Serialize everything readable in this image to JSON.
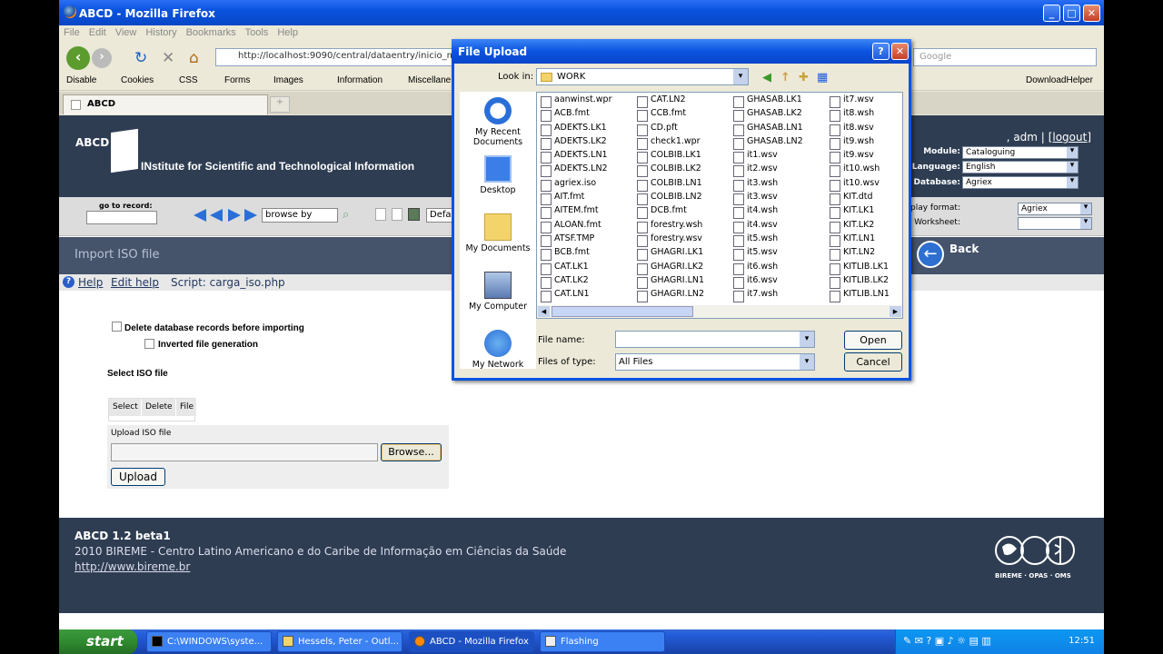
{
  "window": {
    "title": "ABCD - Mozilla Firefox"
  },
  "menu": [
    "File",
    "Edit",
    "View",
    "History",
    "Bookmarks",
    "Tools",
    "Help"
  ],
  "nav": {
    "url": "http://localhost:9090/central/dataentry/inicio_main.ph",
    "search_placeholder": "Google"
  },
  "devbar": {
    "disable": "Disable",
    "cookies": "Cookies",
    "css": "CSS",
    "forms": "Forms",
    "images": "Images",
    "information": "Information",
    "misc": "Miscellane",
    "downloadhelper": "DownloadHelper"
  },
  "tab": {
    "label": "ABCD"
  },
  "header": {
    "abcd": "ABCD",
    "institute": "INstitute for Scientific and Technological Information",
    "user_prefix": ", adm |",
    "logout": "[logout]",
    "module_label": "Module:",
    "module_value": "Cataloguing",
    "language_label": "Language:",
    "language_value": "English",
    "database_label": "Database:",
    "database_value": "Agriex",
    "display_label": "Display format:",
    "display_value": "Agriex",
    "worksheet_label": "Worksheet:",
    "worksheet_value": ""
  },
  "toolbar": {
    "goto_label": "go to record:",
    "browse_by": "browse by",
    "default": "Defa"
  },
  "pagebar": {
    "title": "Import ISO file",
    "back": "Back"
  },
  "helpbar": {
    "help": "Help",
    "edit_help": "Edit help",
    "script": "Script: carga_iso.php"
  },
  "form": {
    "delete_label": "Delete database records before importing",
    "inverted_label": "Inverted file generation",
    "select_iso": "Select ISO file",
    "col_select": "Select",
    "col_delete": "Delete",
    "col_file": "File",
    "upload_iso": "Upload ISO file",
    "browse": "Browse...",
    "upload": "Upload"
  },
  "footer": {
    "version": "ABCD 1.2 beta1",
    "copyright": "2010 BIREME - Centro Latino Americano e do Caribe de Informação em Ciências da Saúde",
    "link": "http://www.bireme.br",
    "logo_text": "BIREME · OPAS · OMS"
  },
  "dialog": {
    "title": "File Upload",
    "lookin_label": "Look in:",
    "lookin_value": "WORK",
    "places": [
      "My Recent Documents",
      "Desktop",
      "My Documents",
      "My Computer",
      "My Network"
    ],
    "files_col1": [
      "aanwinst.wpr",
      "ACB.fmt",
      "ADEKTS.LK1",
      "ADEKTS.LK2",
      "ADEKTS.LN1",
      "ADEKTS.LN2",
      "agriex.iso",
      "AIT.fmt",
      "AITEM.fmt",
      "ALOAN.fmt",
      "ATSF.TMP",
      "BCB.fmt",
      "CAT.LK1",
      "CAT.LK2",
      "CAT.LN1"
    ],
    "files_col2": [
      "CAT.LN2",
      "CCB.fmt",
      "CD.pft",
      "check1.wpr",
      "COLBIB.LK1",
      "COLBIB.LK2",
      "COLBIB.LN1",
      "COLBIB.LN2",
      "DCB.fmt",
      "forestry.wsh",
      "forestry.wsv",
      "GHAGRI.LK1",
      "GHAGRI.LK2",
      "GHAGRI.LN1",
      "GHAGRI.LN2"
    ],
    "files_col3": [
      "GHASAB.LK1",
      "GHASAB.LK2",
      "GHASAB.LN1",
      "GHASAB.LN2",
      "it1.wsv",
      "it2.wsv",
      "it3.wsh",
      "it3.wsv",
      "it4.wsh",
      "it4.wsv",
      "it5.wsh",
      "it5.wsv",
      "it6.wsh",
      "it6.wsv",
      "it7.wsh"
    ],
    "files_col4": [
      "it7.wsv",
      "it8.wsh",
      "it8.wsv",
      "it9.wsh",
      "it9.wsv",
      "it10.wsh",
      "it10.wsv",
      "KIT.dtd",
      "KIT.LK1",
      "KIT.LK2",
      "KIT.LN1",
      "KIT.LN2",
      "KITLIB.LK1",
      "KITLIB.LK2",
      "KITLIB.LN1"
    ],
    "filename_label": "File name:",
    "filename_value": "",
    "filetype_label": "Files of type:",
    "filetype_value": "All Files",
    "open": "Open",
    "cancel": "Cancel"
  },
  "taskbar": {
    "start": "start",
    "items": [
      "C:\\WINDOWS\\syste...",
      "Hessels, Peter - Outl...",
      "ABCD - Mozilla Firefox",
      "Flashing"
    ],
    "clock": "12:51"
  }
}
